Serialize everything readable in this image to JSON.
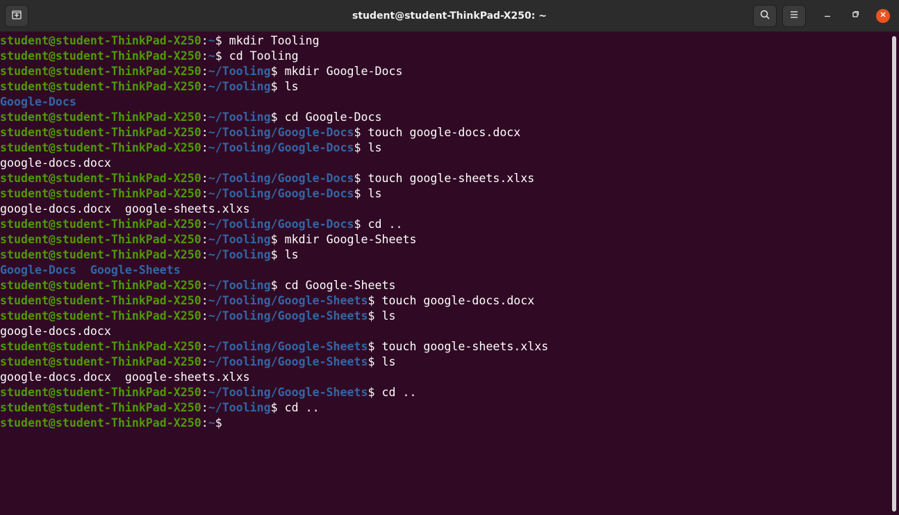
{
  "window": {
    "title": "student@student-ThinkPad-X250: ~"
  },
  "titlebar": {
    "buttons": {
      "new_tab_icon": "new-tab-icon",
      "search_icon": "search-icon",
      "menu_icon": "hamburger-menu-icon",
      "minimize_icon": "minimize-icon",
      "maximize_icon": "maximize-icon",
      "close_icon": "close-icon"
    }
  },
  "colors": {
    "background": "#300a24",
    "prompt_user": "#4e9a06",
    "prompt_path": "#3465a4",
    "directory": "#3465a4",
    "text": "#ffffff",
    "close_button": "#e95420"
  },
  "terminal": {
    "lines": [
      {
        "type": "prompt",
        "user": "student@student-ThinkPad-X250",
        "path": "~",
        "command": " mkdir Tooling"
      },
      {
        "type": "prompt",
        "user": "student@student-ThinkPad-X250",
        "path": "~",
        "command": " cd Tooling"
      },
      {
        "type": "prompt",
        "user": "student@student-ThinkPad-X250",
        "path": "~/Tooling",
        "command": " mkdir Google-Docs"
      },
      {
        "type": "prompt",
        "user": "student@student-ThinkPad-X250",
        "path": "~/Tooling",
        "command": " ls"
      },
      {
        "type": "dir",
        "text": "Google-Docs"
      },
      {
        "type": "prompt",
        "user": "student@student-ThinkPad-X250",
        "path": "~/Tooling",
        "command": " cd Google-Docs"
      },
      {
        "type": "prompt",
        "user": "student@student-ThinkPad-X250",
        "path": "~/Tooling/Google-Docs",
        "command": " touch google-docs.docx"
      },
      {
        "type": "prompt",
        "user": "student@student-ThinkPad-X250",
        "path": "~/Tooling/Google-Docs",
        "command": " ls"
      },
      {
        "type": "output",
        "text": "google-docs.docx"
      },
      {
        "type": "prompt",
        "user": "student@student-ThinkPad-X250",
        "path": "~/Tooling/Google-Docs",
        "command": " touch google-sheets.xlxs"
      },
      {
        "type": "prompt",
        "user": "student@student-ThinkPad-X250",
        "path": "~/Tooling/Google-Docs",
        "command": " ls"
      },
      {
        "type": "output",
        "text": "google-docs.docx  google-sheets.xlxs"
      },
      {
        "type": "prompt",
        "user": "student@student-ThinkPad-X250",
        "path": "~/Tooling/Google-Docs",
        "command": " cd .."
      },
      {
        "type": "prompt",
        "user": "student@student-ThinkPad-X250",
        "path": "~/Tooling",
        "command": " mkdir Google-Sheets"
      },
      {
        "type": "prompt",
        "user": "student@student-ThinkPad-X250",
        "path": "~/Tooling",
        "command": " ls"
      },
      {
        "type": "dir",
        "text": "Google-Docs  Google-Sheets"
      },
      {
        "type": "prompt",
        "user": "student@student-ThinkPad-X250",
        "path": "~/Tooling",
        "command": " cd Google-Sheets"
      },
      {
        "type": "prompt",
        "user": "student@student-ThinkPad-X250",
        "path": "~/Tooling/Google-Sheets",
        "command": " touch google-docs.docx"
      },
      {
        "type": "prompt",
        "user": "student@student-ThinkPad-X250",
        "path": "~/Tooling/Google-Sheets",
        "command": " ls"
      },
      {
        "type": "output",
        "text": "google-docs.docx"
      },
      {
        "type": "prompt",
        "user": "student@student-ThinkPad-X250",
        "path": "~/Tooling/Google-Sheets",
        "command": " touch google-sheets.xlxs"
      },
      {
        "type": "prompt",
        "user": "student@student-ThinkPad-X250",
        "path": "~/Tooling/Google-Sheets",
        "command": " ls"
      },
      {
        "type": "output",
        "text": "google-docs.docx  google-sheets.xlxs"
      },
      {
        "type": "prompt",
        "user": "student@student-ThinkPad-X250",
        "path": "~/Tooling/Google-Sheets",
        "command": " cd .."
      },
      {
        "type": "prompt",
        "user": "student@student-ThinkPad-X250",
        "path": "~/Tooling",
        "command": " cd .."
      },
      {
        "type": "prompt",
        "user": "student@student-ThinkPad-X250",
        "path": "~",
        "command": ""
      }
    ]
  }
}
